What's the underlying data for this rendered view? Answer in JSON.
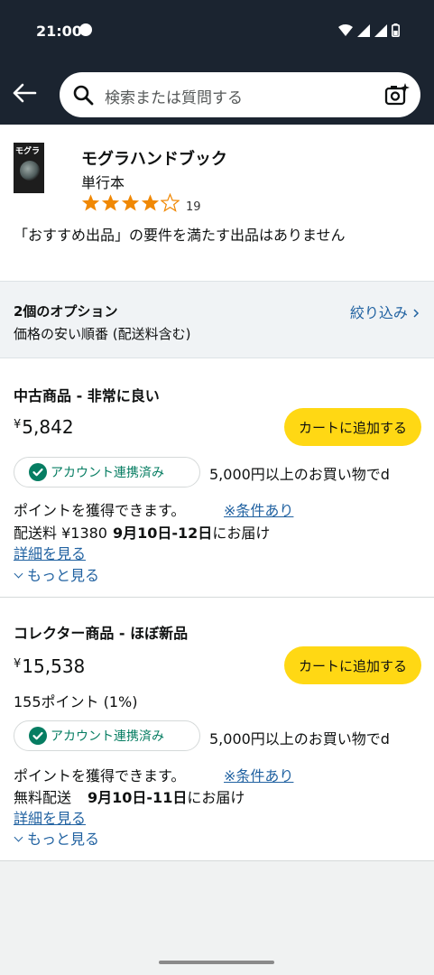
{
  "status": {
    "time": "21:00"
  },
  "search": {
    "placeholder": "検索または質問する"
  },
  "product": {
    "cover_text": "モグラ",
    "title": "モグラハンドブック",
    "format": "単行本",
    "rating": 4,
    "rating_count": "19",
    "message": "「おすすめ出品」の要件を満たす出品はありません"
  },
  "options": {
    "count": "2個のオプション",
    "sort": "価格の安い順番 (配送料含む)",
    "filter": "絞り込み"
  },
  "offers": [
    {
      "condition": "中古商品 - 非常に良い",
      "currency": "¥",
      "price": "5,842",
      "cart": "カートに追加する",
      "linked": "アカウント連携済み",
      "promo": "5,000円以上のお買い物でd",
      "earn": "ポイントを獲得できます。",
      "cond_link": "※条件あり",
      "ship": "配送料 ¥1380",
      "date": "9月10日-12日",
      "deliver": "にお届け",
      "detail": "詳細を見る",
      "more": "もっと見る"
    },
    {
      "condition": "コレクター商品 - ほぼ新品",
      "currency": "¥",
      "price": "15,538",
      "points": "155ポイント (1%)",
      "cart": "カートに追加する",
      "linked": "アカウント連携済み",
      "promo": "5,000円以上のお買い物でd",
      "earn": "ポイントを獲得できます。",
      "cond_link": "※条件あり",
      "ship": "無料配送",
      "date": "9月10日-11日",
      "deliver": "にお届け",
      "detail": "詳細を見る",
      "more": "もっと見る"
    }
  ],
  "colors": {
    "header": "#1b2430",
    "cart_button": "#ffd814",
    "link": "#2162a1",
    "linked_green": "#067d62",
    "star": "#f08804"
  }
}
